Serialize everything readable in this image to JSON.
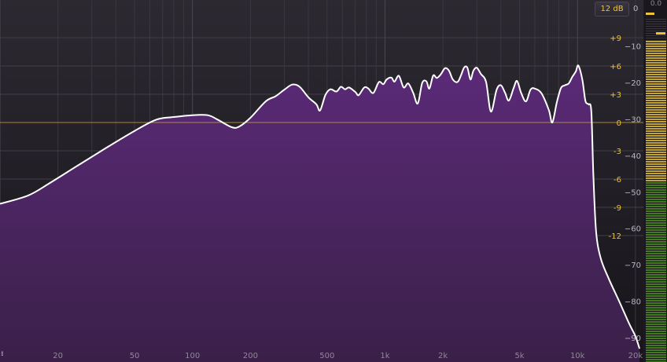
{
  "app": {
    "range_button_label": "12 dB",
    "meter_zero_label": "0",
    "meter_peak_readout": "0.0",
    "resize_handle_glyph": "⁞⁞⁞"
  },
  "colors": {
    "background": "#1e1c22",
    "fill_top": "#5b2a78",
    "fill_bottom": "#3a2048",
    "curve": "#ffffff",
    "zero_line": "#c8a040",
    "gain_labels": "#f0c330",
    "meter_green": "#4f8a24",
    "meter_yellow": "#d6b43a"
  },
  "chart_data": {
    "type": "area",
    "x_scale": "log",
    "xlim": [
      10,
      22000
    ],
    "ylim_db": [
      -93,
      0
    ],
    "gain_range_db": [
      -12,
      12
    ],
    "x_ticks": [
      {
        "value": 20,
        "label": "20"
      },
      {
        "value": 50,
        "label": "50"
      },
      {
        "value": 100,
        "label": "100"
      },
      {
        "value": 200,
        "label": "200"
      },
      {
        "value": 500,
        "label": "500"
      },
      {
        "value": 1000,
        "label": "1k"
      },
      {
        "value": 2000,
        "label": "2k"
      },
      {
        "value": 5000,
        "label": "5k"
      },
      {
        "value": 10000,
        "label": "10k"
      },
      {
        "value": 20000,
        "label": "20k"
      }
    ],
    "gain_ticks": [
      {
        "value": 9,
        "label": "+9"
      },
      {
        "value": 6,
        "label": "+6"
      },
      {
        "value": 3,
        "label": "+3"
      },
      {
        "value": 0,
        "label": "0"
      },
      {
        "value": -3,
        "label": "-3"
      },
      {
        "value": -6,
        "label": "-6"
      },
      {
        "value": -9,
        "label": "-9"
      },
      {
        "value": -12,
        "label": "-12"
      }
    ],
    "db_ticks": [
      {
        "value": -10,
        "label": "-10"
      },
      {
        "value": -20,
        "label": "-20"
      },
      {
        "value": -30,
        "label": "-30"
      },
      {
        "value": -40,
        "label": "-40"
      },
      {
        "value": -50,
        "label": "-50"
      },
      {
        "value": -60,
        "label": "-60"
      },
      {
        "value": -70,
        "label": "-70"
      },
      {
        "value": -80,
        "label": "-80"
      },
      {
        "value": -90,
        "label": "-90"
      }
    ],
    "spectrum": [
      [
        10,
        -53.3
      ],
      [
        14,
        -51
      ],
      [
        18,
        -47.7
      ],
      [
        25,
        -43
      ],
      [
        35,
        -38.2
      ],
      [
        50,
        -33.3
      ],
      [
        65,
        -30.2
      ],
      [
        80,
        -29.5
      ],
      [
        100,
        -29.0
      ],
      [
        120,
        -29.0
      ],
      [
        135,
        -30.2
      ],
      [
        160,
        -32.3
      ],
      [
        175,
        -32.1
      ],
      [
        200,
        -29.7
      ],
      [
        240,
        -25.2
      ],
      [
        270,
        -23.8
      ],
      [
        300,
        -22.0
      ],
      [
        330,
        -20.6
      ],
      [
        360,
        -21.2
      ],
      [
        400,
        -24.1
      ],
      [
        440,
        -26.0
      ],
      [
        460,
        -27.7
      ],
      [
        490,
        -23.5
      ],
      [
        520,
        -21.9
      ],
      [
        560,
        -22.5
      ],
      [
        590,
        -21.2
      ],
      [
        620,
        -21.9
      ],
      [
        650,
        -21.4
      ],
      [
        700,
        -22.6
      ],
      [
        730,
        -23.5
      ],
      [
        780,
        -21.4
      ],
      [
        820,
        -21.7
      ],
      [
        870,
        -22.9
      ],
      [
        930,
        -19.9
      ],
      [
        980,
        -20.5
      ],
      [
        1020,
        -19.2
      ],
      [
        1080,
        -18.7
      ],
      [
        1120,
        -19.8
      ],
      [
        1180,
        -18.2
      ],
      [
        1250,
        -21.4
      ],
      [
        1320,
        -20.3
      ],
      [
        1400,
        -22.8
      ],
      [
        1480,
        -25.8
      ],
      [
        1560,
        -20.2
      ],
      [
        1640,
        -19.7
      ],
      [
        1700,
        -21.7
      ],
      [
        1780,
        -18.1
      ],
      [
        1860,
        -18.8
      ],
      [
        1950,
        -17.8
      ],
      [
        2050,
        -16.1
      ],
      [
        2150,
        -16.8
      ],
      [
        2250,
        -19.2
      ],
      [
        2380,
        -19.9
      ],
      [
        2480,
        -18.1
      ],
      [
        2580,
        -15.9
      ],
      [
        2680,
        -16.0
      ],
      [
        2780,
        -19.2
      ],
      [
        2880,
        -16.8
      ],
      [
        3000,
        -16.0
      ],
      [
        3150,
        -17.7
      ],
      [
        3350,
        -19.9
      ],
      [
        3550,
        -28.0
      ],
      [
        3800,
        -22.0
      ],
      [
        4000,
        -20.8
      ],
      [
        4200,
        -22.8
      ],
      [
        4400,
        -25.0
      ],
      [
        4650,
        -21.7
      ],
      [
        4850,
        -19.6
      ],
      [
        5100,
        -22.9
      ],
      [
        5400,
        -25.2
      ],
      [
        5700,
        -22.0
      ],
      [
        6000,
        -21.7
      ],
      [
        6500,
        -23.0
      ],
      [
        7100,
        -27.6
      ],
      [
        7400,
        -31.0
      ],
      [
        7800,
        -25.6
      ],
      [
        8200,
        -21.6
      ],
      [
        8600,
        -20.8
      ],
      [
        9000,
        -20.3
      ],
      [
        9400,
        -18.5
      ],
      [
        9800,
        -17.0
      ],
      [
        10100,
        -15.4
      ],
      [
        10600,
        -19.3
      ],
      [
        11000,
        -25.1
      ],
      [
        11400,
        -26.0
      ],
      [
        11800,
        -28.0
      ],
      [
        12100,
        -46.0
      ],
      [
        12500,
        -61.0
      ],
      [
        13200,
        -68.2
      ],
      [
        14500,
        -73.7
      ],
      [
        16500,
        -80.1
      ],
      [
        18500,
        -86.0
      ],
      [
        20000,
        -89.6
      ],
      [
        21000,
        -93.0
      ]
    ]
  }
}
